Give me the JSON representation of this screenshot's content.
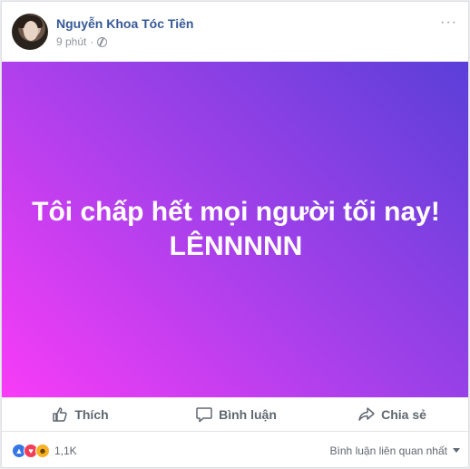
{
  "post": {
    "author": "Nguyễn Khoa Tóc Tiên",
    "time": "9 phút",
    "separator": "·",
    "more_label": "···",
    "text_line1": "Tôi chấp hết mọi người tối nay!",
    "text_line2": "LÊNNNNN",
    "gradient": [
      "#f83cf7",
      "#a340ea",
      "#5a3fd8"
    ]
  },
  "actions": {
    "like": "Thích",
    "comment": "Bình luận",
    "share": "Chia sẻ"
  },
  "footer": {
    "reaction_count": "1,1K",
    "reactions": [
      "like-icon",
      "love-icon",
      "haha-icon"
    ],
    "sort_label": "Bình luận liên quan nhất"
  },
  "colors": {
    "name": "#365899",
    "meta": "#90949c",
    "action": "#606770"
  }
}
